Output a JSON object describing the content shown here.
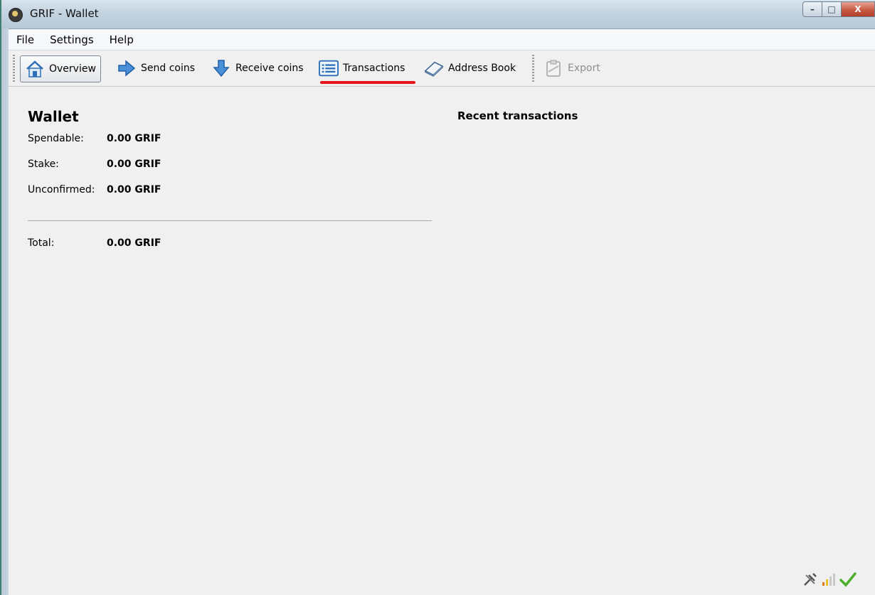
{
  "window": {
    "title": "GRIF - Wallet",
    "controls": {
      "minimize": "–",
      "maximize": "□",
      "close": "X"
    }
  },
  "menu": {
    "items": [
      "File",
      "Settings",
      "Help"
    ]
  },
  "toolbar": {
    "overview": "Overview",
    "send_coins": "Send coins",
    "receive_coins": "Receive coins",
    "transactions": "Transactions",
    "address_book": "Address Book",
    "export": "Export"
  },
  "annotation": {
    "number": "1",
    "color": "#e5151d"
  },
  "wallet": {
    "title": "Wallet",
    "spendable_label": "Spendable:",
    "spendable_value": "0.00 GRIF",
    "stake_label": "Stake:",
    "stake_value": "0.00 GRIF",
    "unconfirmed_label": "Unconfirmed:",
    "unconfirmed_value": "0.00 GRIF",
    "total_label": "Total:",
    "total_value": "0.00 GRIF"
  },
  "recent": {
    "title": "Recent transactions"
  },
  "status": {
    "icons": [
      "tools-icon",
      "signal-bars-icon",
      "checkmark-icon"
    ]
  }
}
